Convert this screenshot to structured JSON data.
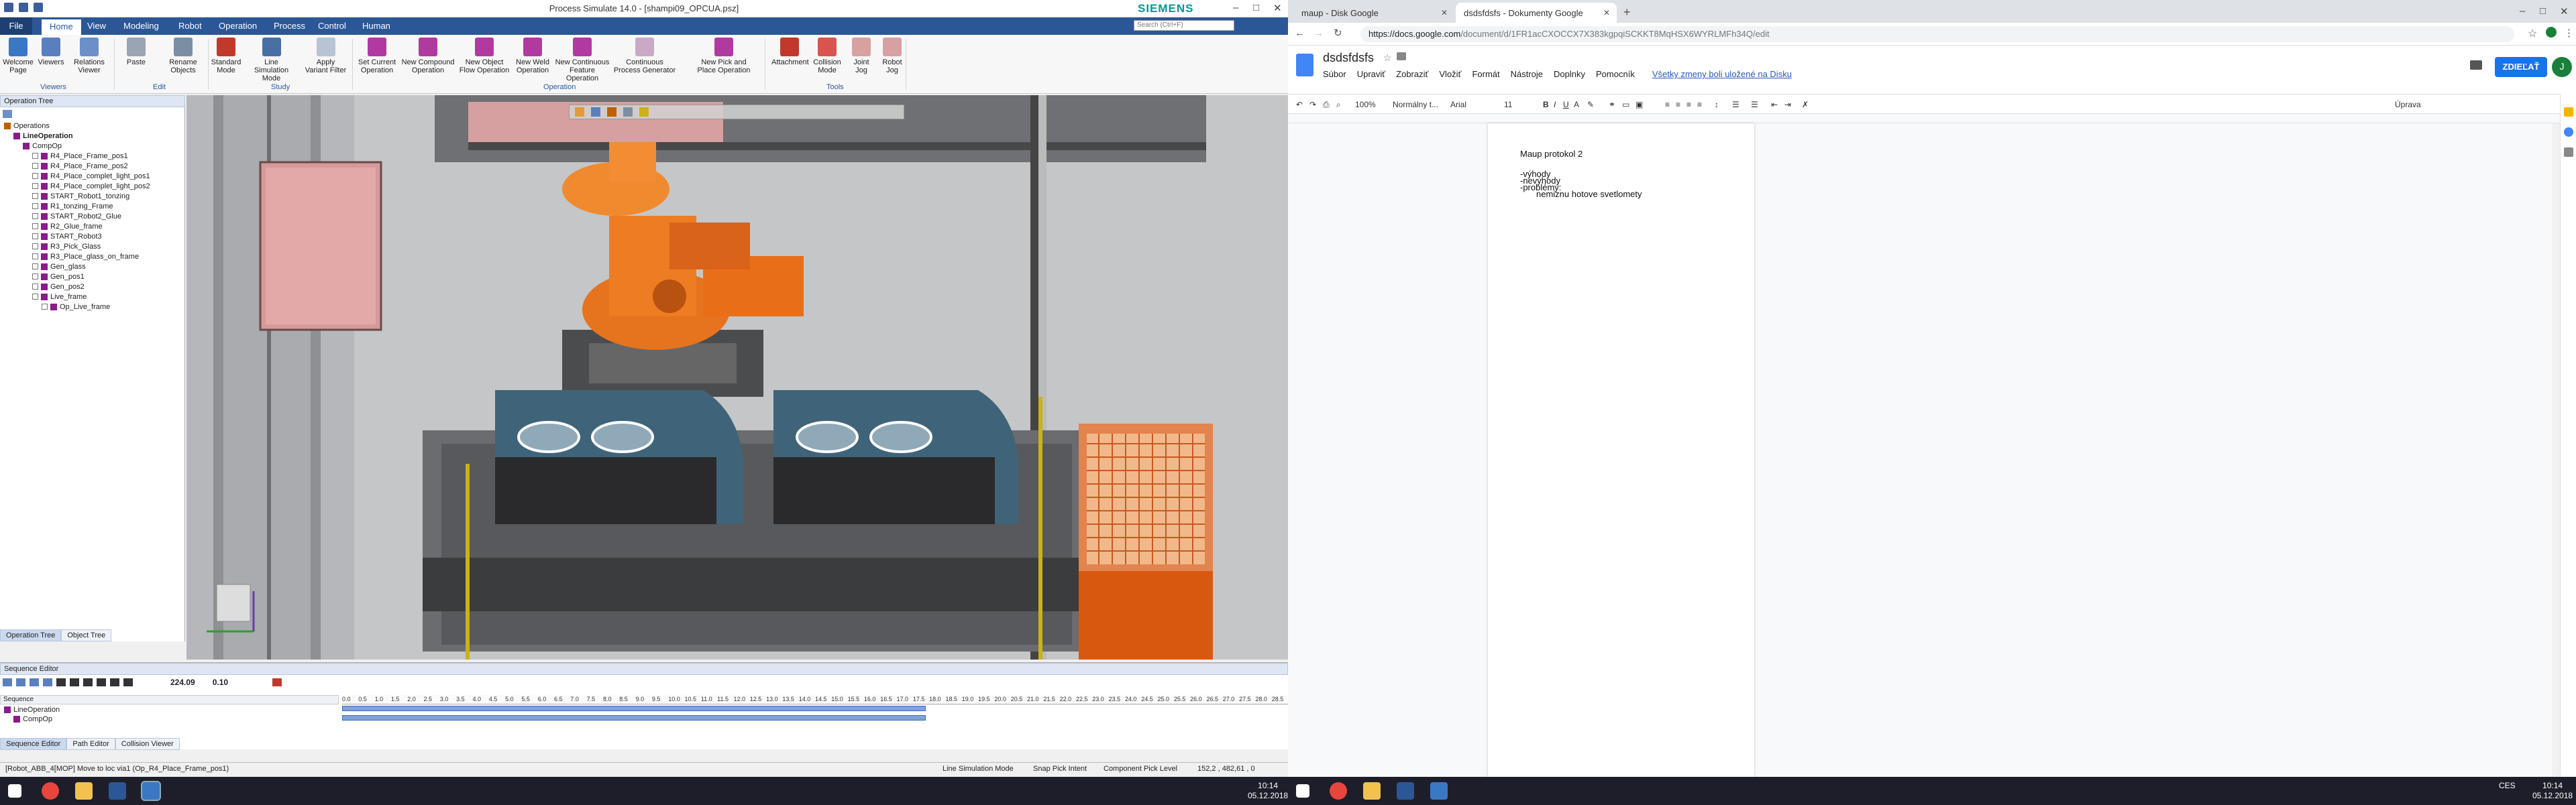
{
  "ps": {
    "window_title": "Process Simulate 14.0 - [shampi09_OPCUA.psz]",
    "brand": "SIEMENS",
    "search_placeholder": "Search (Ctrl+F)",
    "menu": [
      "File",
      "Home",
      "View",
      "Modeling",
      "Robot",
      "Operation",
      "Process",
      "Control",
      "Human"
    ],
    "ribbon_buttons": [
      {
        "label": "Welcome\nPage",
        "color": "#3b78c4"
      },
      {
        "label": "Viewers",
        "color": "#5a7fbf"
      },
      {
        "label": "Relations\nViewer",
        "color": "#6b8fc8"
      },
      {
        "label": "Paste",
        "color": "#9aa4b2"
      },
      {
        "label": "Rename\nObjects",
        "color": "#7c8ea4"
      },
      {
        "label": "Standard\nMode",
        "color": "#c0392b"
      },
      {
        "label": "Line Simulation\nMode",
        "color": "#4a6fa5"
      },
      {
        "label": "Apply\nVariant Filter",
        "color": "#b8c4d4"
      },
      {
        "label": "Set Current\nOperation",
        "color": "#b03aa0"
      },
      {
        "label": "New Compound\nOperation",
        "color": "#b03aa0"
      },
      {
        "label": "New Object\nFlow Operation",
        "color": "#b03aa0"
      },
      {
        "label": "New Weld\nOperation",
        "color": "#b03aa0"
      },
      {
        "label": "New Continuous\nFeature Operation",
        "color": "#b03aa0"
      },
      {
        "label": "Continuous\nProcess Generator",
        "color": "#c9a9c5"
      },
      {
        "label": "New Pick and\nPlace Operation",
        "color": "#b03aa0"
      },
      {
        "label": "Attachment",
        "color": "#c0392b"
      },
      {
        "label": "Collision\nMode",
        "color": "#d9534f"
      },
      {
        "label": "Joint\nJog",
        "color": "#d8a0a0"
      },
      {
        "label": "Robot\nJog",
        "color": "#d8a0a0"
      }
    ],
    "ribbon_groups": [
      "Viewers",
      "Edit",
      "Study",
      "Operation",
      "Tools"
    ],
    "optree_title": "Operation Tree",
    "tree": [
      {
        "label": "Operations",
        "level": 0,
        "color": "#c06000"
      },
      {
        "label": "LineOperation",
        "level": 1,
        "color": "#8b1a8b"
      },
      {
        "label": "CompOp",
        "level": 2,
        "color": "#8b1a8b"
      },
      {
        "label": "R4_Place_Frame_pos1",
        "level": 3,
        "color": "#8b1a8b"
      },
      {
        "label": "R4_Place_Frame_pos2",
        "level": 3,
        "color": "#8b1a8b"
      },
      {
        "label": "R4_Place_complet_light_pos1",
        "level": 3,
        "color": "#8b1a8b"
      },
      {
        "label": "R4_Place_complet_light_pos2",
        "level": 3,
        "color": "#8b1a8b"
      },
      {
        "label": "START_Robot1_tonzing",
        "level": 3,
        "color": "#8b1a8b"
      },
      {
        "label": "R1_tonzing_Frame",
        "level": 3,
        "color": "#8b1a8b"
      },
      {
        "label": "START_Robot2_Glue",
        "level": 3,
        "color": "#8b1a8b"
      },
      {
        "label": "R2_Glue_frame",
        "level": 3,
        "color": "#8b1a8b"
      },
      {
        "label": "START_Robot3",
        "level": 3,
        "color": "#8b1a8b"
      },
      {
        "label": "R3_Pick_Glass",
        "level": 3,
        "color": "#8b1a8b"
      },
      {
        "label": "R3_Place_glass_on_frame",
        "level": 3,
        "color": "#8b1a8b"
      },
      {
        "label": "Gen_glass",
        "level": 3,
        "color": "#8b1a8b"
      },
      {
        "label": "Gen_pos1",
        "level": 3,
        "color": "#8b1a8b"
      },
      {
        "label": "Gen_pos2",
        "level": 3,
        "color": "#8b1a8b"
      },
      {
        "label": "Live_frame",
        "level": 3,
        "color": "#8b1a8b"
      },
      {
        "label": "Op_Live_frame",
        "level": 4,
        "color": "#8b1a8b"
      }
    ],
    "left_tabs": [
      "Operation Tree",
      "Object Tree"
    ],
    "seq_title": "Sequence Editor",
    "seq_time": "224.09",
    "seq_step": "0.10",
    "seq_rows": [
      "LineOperation",
      "CompOp"
    ],
    "seq_header": "Sequence",
    "ticks": [
      "0.0",
      "0.5",
      "1.0",
      "1.5",
      "2.0",
      "2.5",
      "3.0",
      "3.5",
      "4.0",
      "4.5",
      "5.0",
      "5.5",
      "6.0",
      "6.5",
      "7.0",
      "7.5",
      "8.0",
      "8.5",
      "9.0",
      "9.5",
      "10.0",
      "10.5",
      "11.0",
      "11.5",
      "12.0",
      "12.5",
      "13.0",
      "13.5",
      "14.0",
      "14.5",
      "15.0",
      "15.5",
      "16.0",
      "16.5",
      "17.0",
      "17.5",
      "18.0",
      "18.5",
      "19.0",
      "19.5",
      "20.0",
      "20.5",
      "21.0",
      "21.5",
      "22.0",
      "22.5",
      "23.0",
      "23.5",
      "24.0",
      "24.5",
      "25.0",
      "25.5",
      "26.0",
      "26.5",
      "27.0",
      "27.5",
      "28.0",
      "28.5"
    ],
    "bottom_tabs": [
      "Sequence Editor",
      "Path Editor",
      "Collision Viewer"
    ],
    "status_left": "[Robot_ABB_4[MOP] Move to loc via1 (Op_R4_Place_Frame_pos1)",
    "status_mode": "Line Simulation Mode",
    "status_snap": "Snap Pick Intent",
    "status_pick": "Component Pick Level",
    "status_coords": "152,2 , 482,61 , 0",
    "clock_time": "10:14",
    "clock_date": "05.12.2018"
  },
  "chrome": {
    "tabs": [
      "maup - Disk Google",
      "dsdsfdsfs - Dokumenty Google"
    ],
    "url_host": "https://docs.google.com",
    "url_path": "/document/d/1FR1acCXOCCX7X383kgpqiSCKKT8MqHSX6WYRLMFh34Q/edit",
    "doc_title": "dsdsfdsfs",
    "menu": [
      "Súbor",
      "Upraviť",
      "Zobraziť",
      "Vložiť",
      "Formát",
      "Nástroje",
      "Doplnky",
      "Pomocník"
    ],
    "saved_msg": "Všetky zmeny boli uložené na Disku",
    "share_label": "ZDIEĽAŤ",
    "avatar": "J",
    "zoom": "100%",
    "style": "Normálny t...",
    "font": "Arial",
    "size": "11",
    "mode": "Úprava",
    "doc_lines": [
      "Maup protokol 2",
      "",
      "-výhody",
      "-nevýhody",
      "-problémy:",
      "nemiznu hotove svetlomety"
    ],
    "clock_time": "10:14",
    "clock_date": "05.12.2018",
    "lang": "CES"
  }
}
